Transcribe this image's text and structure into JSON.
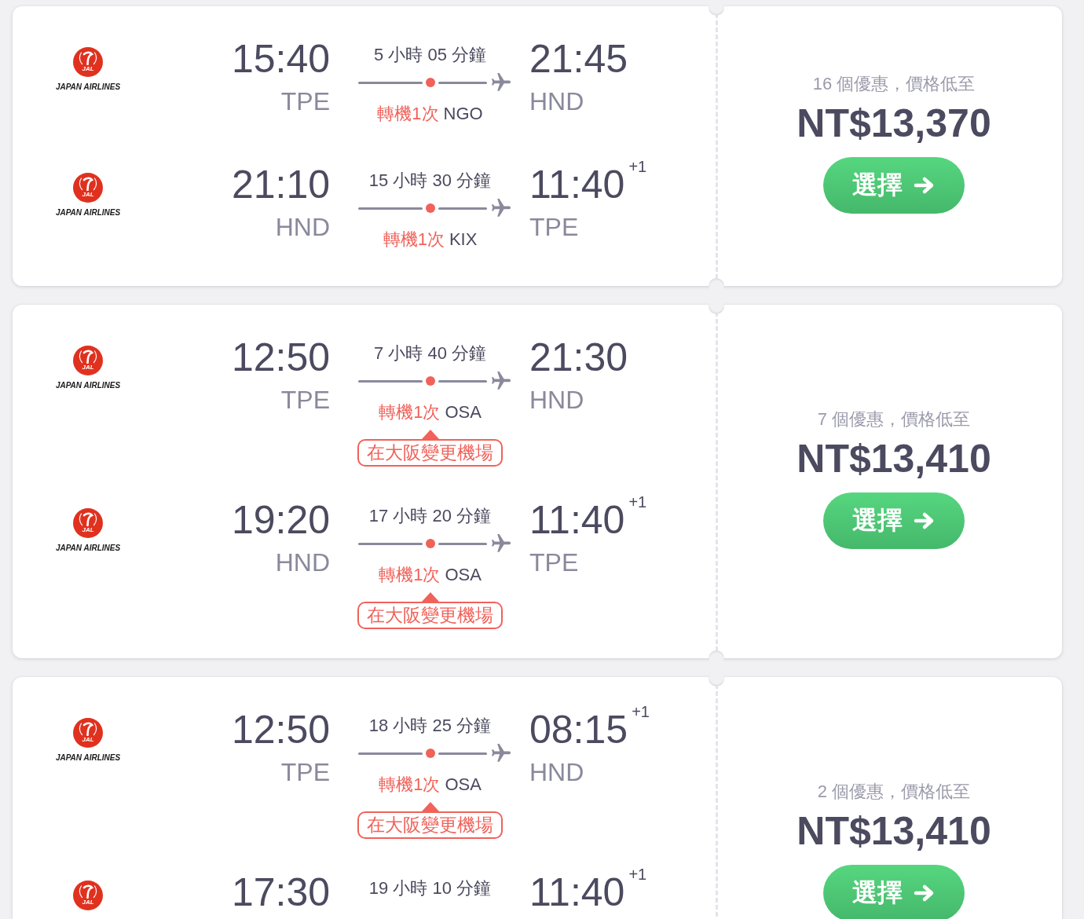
{
  "results": [
    {
      "legs": [
        {
          "airline": {
            "mark": "JAL",
            "name": "JAPAN AIRLINES"
          },
          "depart": {
            "time": "15:40",
            "airport": "TPE"
          },
          "duration": "5 小時 05 分鐘",
          "stops": "轉機1次",
          "via": "NGO",
          "arrive": {
            "time": "21:45",
            "airport": "HND"
          }
        },
        {
          "airline": {
            "mark": "JAL",
            "name": "JAPAN AIRLINES"
          },
          "depart": {
            "time": "21:10",
            "airport": "HND"
          },
          "duration": "15 小時 30 分鐘",
          "stops": "轉機1次",
          "via": "KIX",
          "arrive": {
            "time": "11:40",
            "day_offset": "+1",
            "airport": "TPE"
          }
        }
      ],
      "offers": "16 個優惠，價格低至",
      "price": "NT$13,370",
      "button": "選擇"
    },
    {
      "legs": [
        {
          "airline": {
            "mark": "JAL",
            "name": "JAPAN AIRLINES"
          },
          "depart": {
            "time": "12:50",
            "airport": "TPE"
          },
          "duration": "7 小時 40 分鐘",
          "stops": "轉機1次",
          "via": "OSA",
          "airport_change": "在大阪變更機場",
          "arrive": {
            "time": "21:30",
            "airport": "HND"
          }
        },
        {
          "airline": {
            "mark": "JAL",
            "name": "JAPAN AIRLINES"
          },
          "depart": {
            "time": "19:20",
            "airport": "HND"
          },
          "duration": "17 小時 20 分鐘",
          "stops": "轉機1次",
          "via": "OSA",
          "airport_change": "在大阪變更機場",
          "arrive": {
            "time": "11:40",
            "day_offset": "+1",
            "airport": "TPE"
          }
        }
      ],
      "offers": "7 個優惠，價格低至",
      "price": "NT$13,410",
      "button": "選擇"
    },
    {
      "legs": [
        {
          "airline": {
            "mark": "JAL",
            "name": "JAPAN AIRLINES"
          },
          "depart": {
            "time": "12:50",
            "airport": "TPE"
          },
          "duration": "18 小時 25 分鐘",
          "stops": "轉機1次",
          "via": "OSA",
          "airport_change": "在大阪變更機場",
          "arrive": {
            "time": "08:15",
            "day_offset": "+1",
            "airport": "HND"
          }
        },
        {
          "airline": {
            "mark": "JAL"
          },
          "depart": {
            "time": "17:30"
          },
          "duration": "19 小時 10 分鐘",
          "arrive": {
            "time": "11:40",
            "day_offset": "+1"
          }
        }
      ],
      "offers": "2 個優惠，價格低至",
      "price": "NT$13,410",
      "button": "選擇"
    }
  ]
}
